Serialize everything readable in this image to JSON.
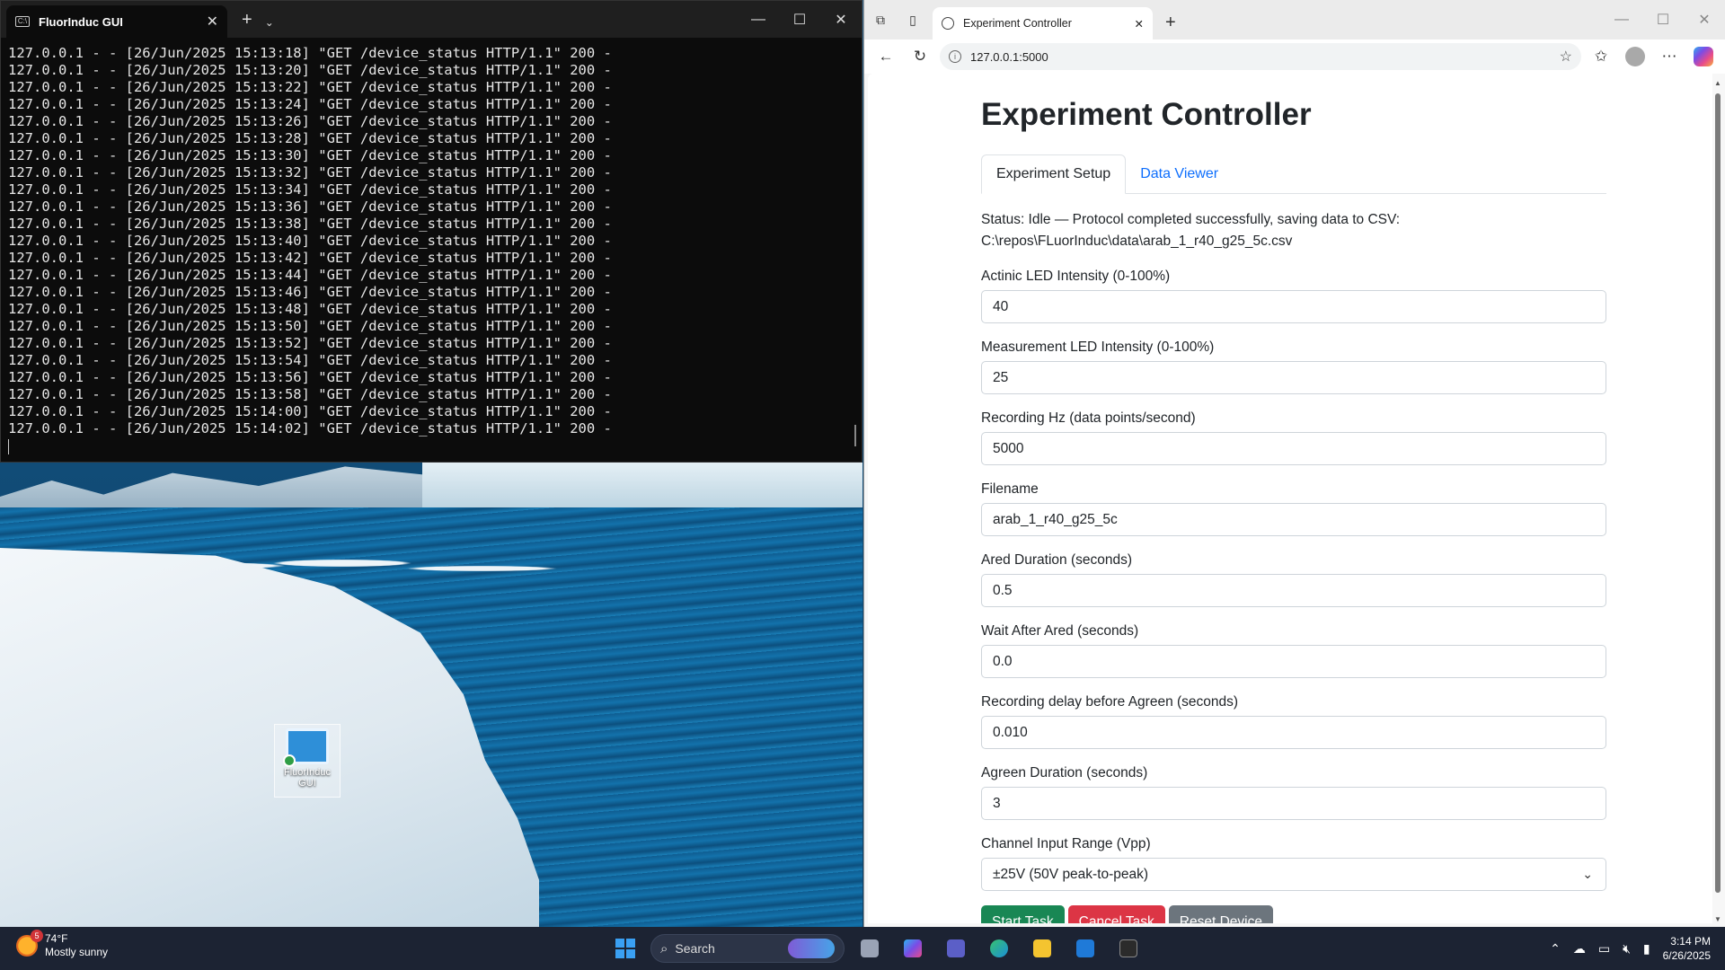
{
  "terminal": {
    "tab_title": "FluorInduc GUI",
    "log_lines": [
      "127.0.0.1 - - [26/Jun/2025 15:13:18] \"GET /device_status HTTP/1.1\" 200 -",
      "127.0.0.1 - - [26/Jun/2025 15:13:20] \"GET /device_status HTTP/1.1\" 200 -",
      "127.0.0.1 - - [26/Jun/2025 15:13:22] \"GET /device_status HTTP/1.1\" 200 -",
      "127.0.0.1 - - [26/Jun/2025 15:13:24] \"GET /device_status HTTP/1.1\" 200 -",
      "127.0.0.1 - - [26/Jun/2025 15:13:26] \"GET /device_status HTTP/1.1\" 200 -",
      "127.0.0.1 - - [26/Jun/2025 15:13:28] \"GET /device_status HTTP/1.1\" 200 -",
      "127.0.0.1 - - [26/Jun/2025 15:13:30] \"GET /device_status HTTP/1.1\" 200 -",
      "127.0.0.1 - - [26/Jun/2025 15:13:32] \"GET /device_status HTTP/1.1\" 200 -",
      "127.0.0.1 - - [26/Jun/2025 15:13:34] \"GET /device_status HTTP/1.1\" 200 -",
      "127.0.0.1 - - [26/Jun/2025 15:13:36] \"GET /device_status HTTP/1.1\" 200 -",
      "127.0.0.1 - - [26/Jun/2025 15:13:38] \"GET /device_status HTTP/1.1\" 200 -",
      "127.0.0.1 - - [26/Jun/2025 15:13:40] \"GET /device_status HTTP/1.1\" 200 -",
      "127.0.0.1 - - [26/Jun/2025 15:13:42] \"GET /device_status HTTP/1.1\" 200 -",
      "127.0.0.1 - - [26/Jun/2025 15:13:44] \"GET /device_status HTTP/1.1\" 200 -",
      "127.0.0.1 - - [26/Jun/2025 15:13:46] \"GET /device_status HTTP/1.1\" 200 -",
      "127.0.0.1 - - [26/Jun/2025 15:13:48] \"GET /device_status HTTP/1.1\" 200 -",
      "127.0.0.1 - - [26/Jun/2025 15:13:50] \"GET /device_status HTTP/1.1\" 200 -",
      "127.0.0.1 - - [26/Jun/2025 15:13:52] \"GET /device_status HTTP/1.1\" 200 -",
      "127.0.0.1 - - [26/Jun/2025 15:13:54] \"GET /device_status HTTP/1.1\" 200 -",
      "127.0.0.1 - - [26/Jun/2025 15:13:56] \"GET /device_status HTTP/1.1\" 200 -",
      "127.0.0.1 - - [26/Jun/2025 15:13:58] \"GET /device_status HTTP/1.1\" 200 -",
      "127.0.0.1 - - [26/Jun/2025 15:14:00] \"GET /device_status HTTP/1.1\" 200 -",
      "127.0.0.1 - - [26/Jun/2025 15:14:02] \"GET /device_status HTTP/1.1\" 200 -"
    ]
  },
  "desktop": {
    "icon_label": "FluorInduc GUI"
  },
  "browser": {
    "tab_title": "Experiment Controller",
    "url": "127.0.0.1:5000"
  },
  "page": {
    "title": "Experiment Controller",
    "tabs": [
      {
        "label": "Experiment Setup"
      },
      {
        "label": "Data Viewer"
      }
    ],
    "status": "Status: Idle — Protocol completed successfully, saving data to CSV: C:\\repos\\FLuorInduc\\data\\arab_1_r40_g25_5c.csv",
    "fields": [
      {
        "label": "Actinic LED Intensity (0-100%)",
        "value": "40"
      },
      {
        "label": "Measurement LED Intensity (0-100%)",
        "value": "25"
      },
      {
        "label": "Recording Hz (data points/second)",
        "value": "5000"
      },
      {
        "label": "Filename",
        "value": "arab_1_r40_g25_5c"
      },
      {
        "label": "Ared Duration (seconds)",
        "value": "0.5"
      },
      {
        "label": "Wait After Ared (seconds)",
        "value": "0.0"
      },
      {
        "label": "Recording delay before Agreen (seconds)",
        "value": "0.010"
      },
      {
        "label": "Agreen Duration (seconds)",
        "value": "3"
      }
    ],
    "channel_range": {
      "label": "Channel Input Range (Vpp)",
      "selected": "±25V (50V peak-to-peak)"
    },
    "buttons": {
      "start": "Start Task",
      "cancel": "Cancel Task",
      "reset": "Reset Device"
    }
  },
  "taskbar": {
    "weather_badge": "5",
    "weather_temp": "74°F",
    "weather_desc": "Mostly sunny",
    "search_placeholder": "Search",
    "time": "3:14 PM",
    "date": "6/26/2025"
  },
  "colors": {
    "start_button": "#198754",
    "cancel_button": "#dc3545",
    "reset_button": "#6c757d",
    "link": "#0d6efd"
  }
}
